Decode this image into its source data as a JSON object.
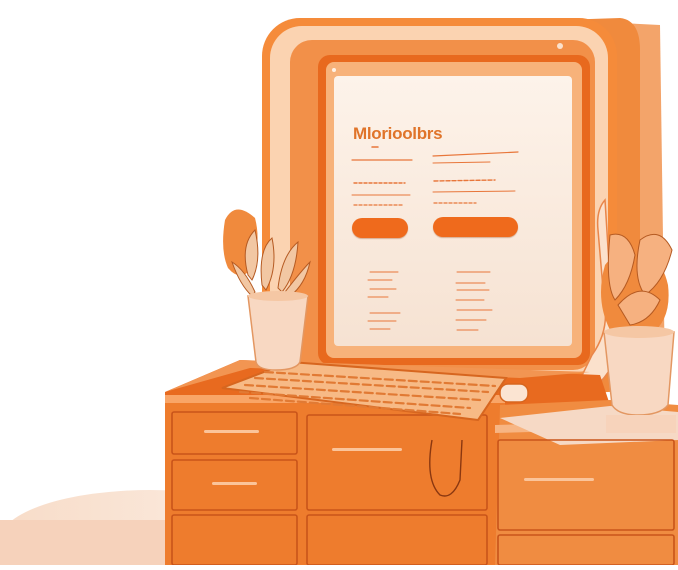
{
  "screen": {
    "brand_text": "Mlorioolbrs",
    "left_button_label": "",
    "right_button_label": ""
  },
  "palette": {
    "orange_primary": "#ef7a2a",
    "orange_dark": "#d9601a",
    "orange_light": "#f6a35e",
    "peach": "#f7d6bf",
    "cream": "#fbeee2",
    "screen_bg": "#f9ece0"
  },
  "icons": {
    "keyboard": "keyboard-icon",
    "plant_left": "potted-plant-icon",
    "plant_right": "potted-plant-icon"
  }
}
